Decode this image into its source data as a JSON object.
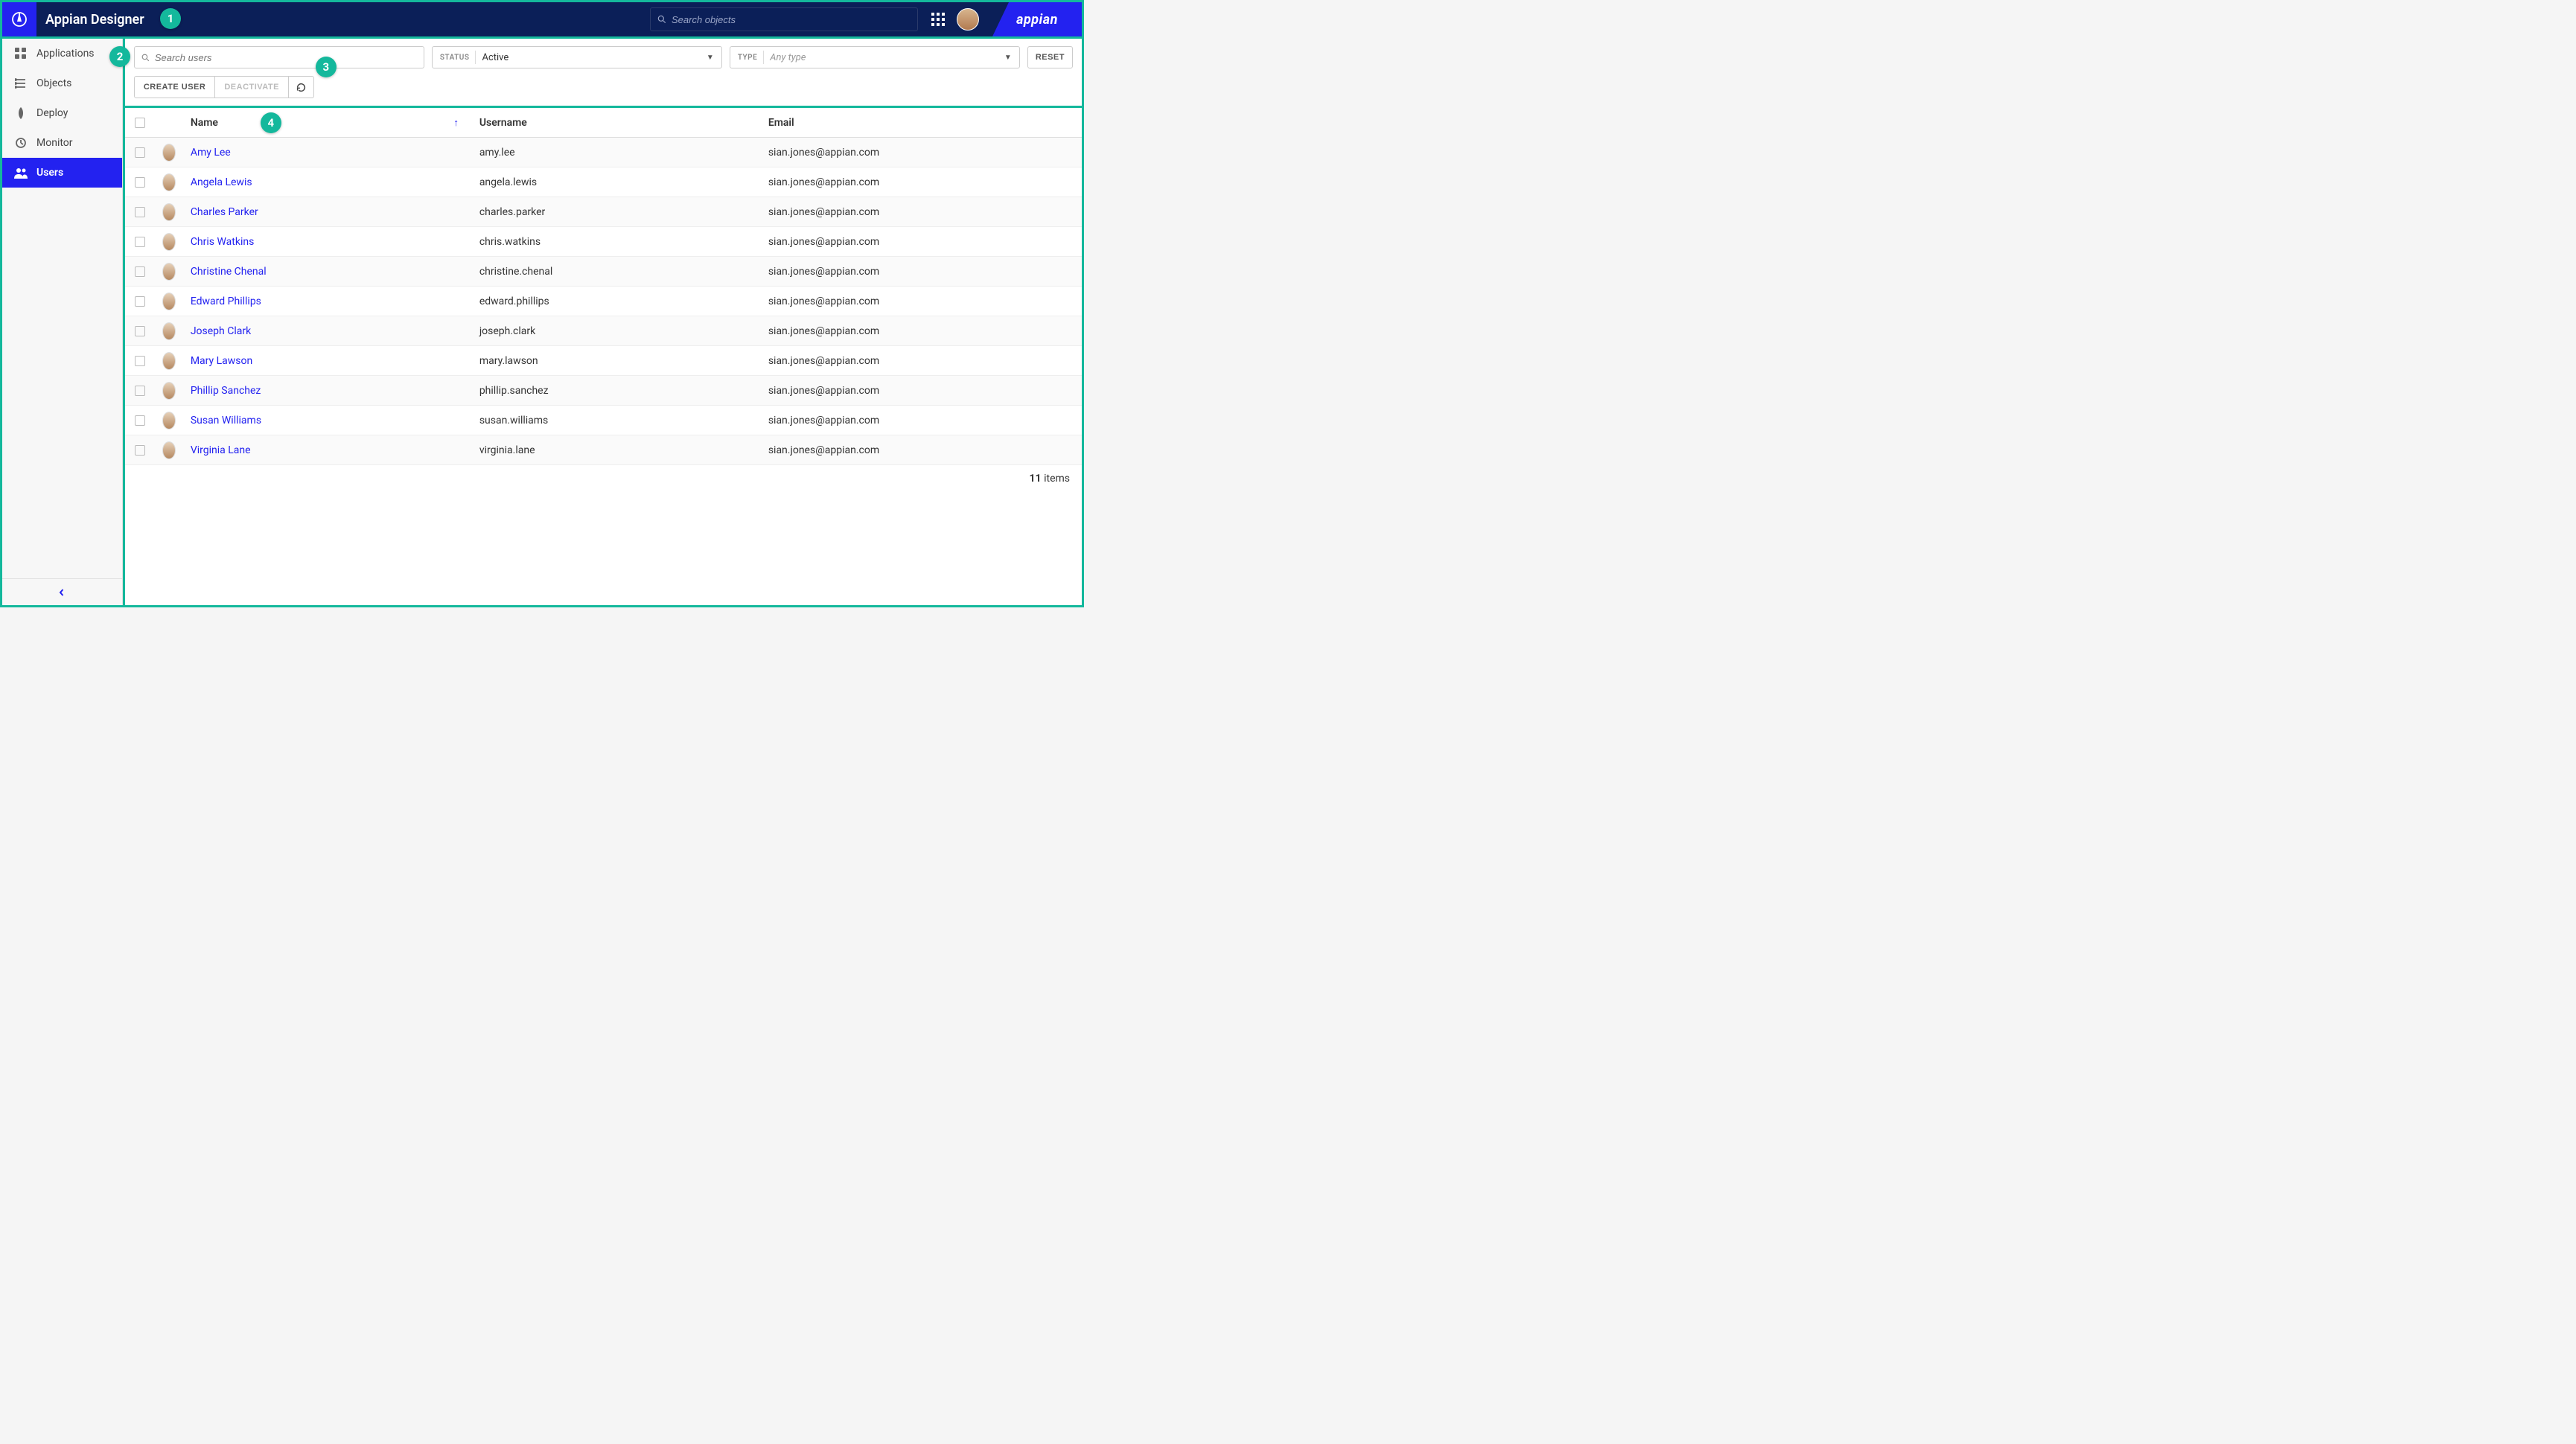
{
  "header": {
    "title": "Appian Designer",
    "search_placeholder": "Search objects",
    "brand": "appian"
  },
  "callouts": {
    "c1": "1",
    "c2": "2",
    "c3": "3",
    "c4": "4"
  },
  "sidebar": {
    "items": [
      {
        "label": "Applications"
      },
      {
        "label": "Objects"
      },
      {
        "label": "Deploy"
      },
      {
        "label": "Monitor"
      },
      {
        "label": "Users"
      }
    ],
    "active_index": 4
  },
  "filters": {
    "search_placeholder": "Search users",
    "status_label": "STATUS",
    "status_value": "Active",
    "type_label": "TYPE",
    "type_placeholder": "Any type",
    "reset_label": "RESET"
  },
  "actions": {
    "create_user": "CREATE USER",
    "deactivate": "DEACTIVATE"
  },
  "table": {
    "columns": {
      "name": "Name",
      "username": "Username",
      "email": "Email"
    },
    "rows": [
      {
        "name": "Amy Lee",
        "username": "amy.lee",
        "email": "sian.jones@appian.com"
      },
      {
        "name": "Angela Lewis",
        "username": "angela.lewis",
        "email": "sian.jones@appian.com"
      },
      {
        "name": "Charles Parker",
        "username": "charles.parker",
        "email": "sian.jones@appian.com"
      },
      {
        "name": "Chris Watkins",
        "username": "chris.watkins",
        "email": "sian.jones@appian.com"
      },
      {
        "name": "Christine Chenal",
        "username": "christine.chenal",
        "email": "sian.jones@appian.com"
      },
      {
        "name": "Edward Phillips",
        "username": "edward.phillips",
        "email": "sian.jones@appian.com"
      },
      {
        "name": "Joseph Clark",
        "username": "joseph.clark",
        "email": "sian.jones@appian.com"
      },
      {
        "name": "Mary Lawson",
        "username": "mary.lawson",
        "email": "sian.jones@appian.com"
      },
      {
        "name": "Phillip Sanchez",
        "username": "phillip.sanchez",
        "email": "sian.jones@appian.com"
      },
      {
        "name": "Susan Williams",
        "username": "susan.williams",
        "email": "sian.jones@appian.com"
      },
      {
        "name": "Virginia Lane",
        "username": "virginia.lane",
        "email": "sian.jones@appian.com"
      }
    ],
    "items_count": "11",
    "items_label": "items"
  }
}
